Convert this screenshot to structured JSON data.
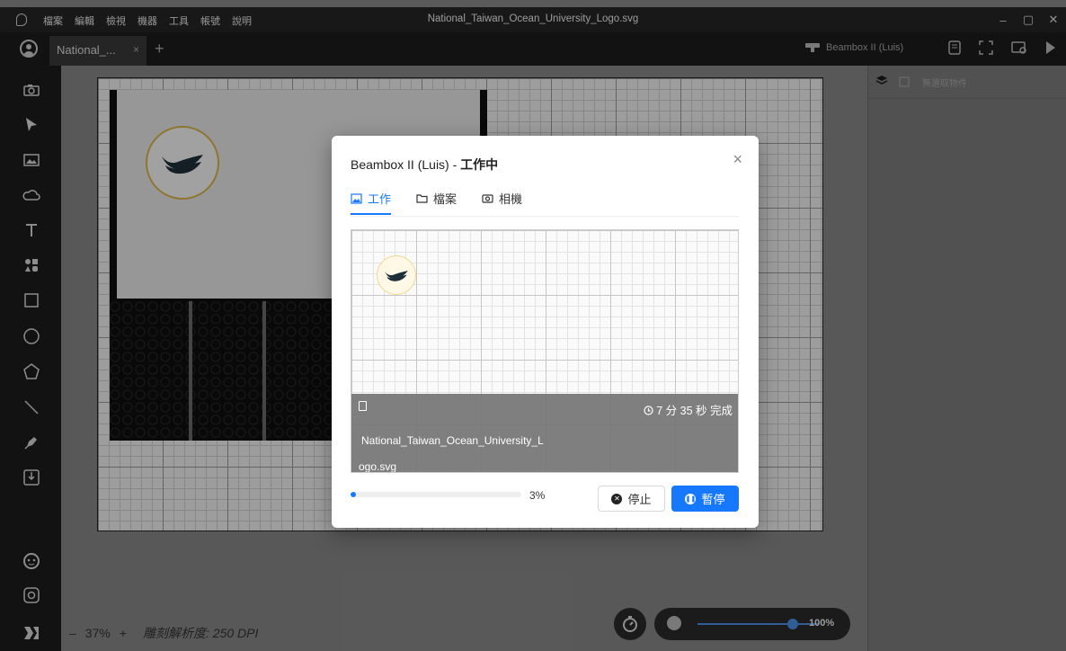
{
  "titlebar": {
    "menus": [
      "檔案",
      "編輯",
      "檢視",
      "機器",
      "工具",
      "帳號",
      "說明"
    ],
    "window_title": "National_Taiwan_Ocean_University_Logo.svg",
    "minimize": "–",
    "maximize": "▢",
    "close": "✕"
  },
  "tabbar": {
    "doc_tab_label": "National_...",
    "doc_tab_close": "×",
    "add_tab": "+",
    "machine_name": "Beambox II (Luis)"
  },
  "right_panel": {
    "no_object": "無選取物件"
  },
  "bottom": {
    "zoom_minus": "–",
    "zoom_value": "37%",
    "zoom_plus": "+",
    "dpi_label": "雕刻解析度: 250 DPI",
    "opacity_value": "100%"
  },
  "modal": {
    "title_machine": "Beambox II (Luis) - ",
    "title_status": "工作中",
    "close": "×",
    "tabs": [
      {
        "label": "工作",
        "icon": "image-icon"
      },
      {
        "label": "檔案",
        "icon": "folder-icon"
      },
      {
        "label": "相機",
        "icon": "camera-icon"
      }
    ],
    "time_remaining": "7 分 35 秒 完成",
    "file_name_line1": "National_Taiwan_Ocean_University_L",
    "file_name_line2": "ogo.svg",
    "progress": 0.03,
    "progress_text": "3%",
    "stop_label": "停止",
    "pause_label": "暫停"
  },
  "colors": {
    "accent": "#1677ff",
    "seal_gold": "#d9b54a"
  }
}
